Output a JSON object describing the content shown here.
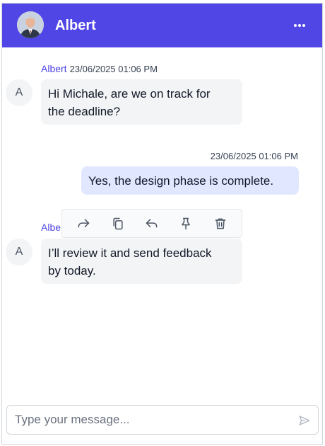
{
  "header": {
    "contact_name": "Albert",
    "avatar_icon": "user-photo",
    "menu_icon": "more-horizontal-icon",
    "background_color": "#5046e5"
  },
  "messages": [
    {
      "direction": "incoming",
      "sender": "Albert",
      "timestamp": "23/06/2025 01:06 PM",
      "avatar_letter": "A",
      "text_line1": "Hi Michale, are we on track for",
      "text_line2": "the deadline?"
    },
    {
      "direction": "outgoing",
      "timestamp": "23/06/2025 01:06 PM",
      "text": "Yes, the design phase is complete."
    },
    {
      "direction": "incoming",
      "sender_partial": "Albe",
      "avatar_letter": "A",
      "text_line1": "I’ll review it and send feedback",
      "text_line2": "by today."
    }
  ],
  "message_toolbar": {
    "actions": [
      "forward-icon",
      "copy-icon",
      "reply-icon",
      "pin-icon",
      "delete-icon"
    ]
  },
  "composer": {
    "placeholder": "Type your message...",
    "value": "",
    "send_icon": "send-icon"
  },
  "colors": {
    "accent": "#5046e5",
    "incoming_bubble": "#f3f4f6",
    "outgoing_bubble": "#e0e7ff"
  }
}
